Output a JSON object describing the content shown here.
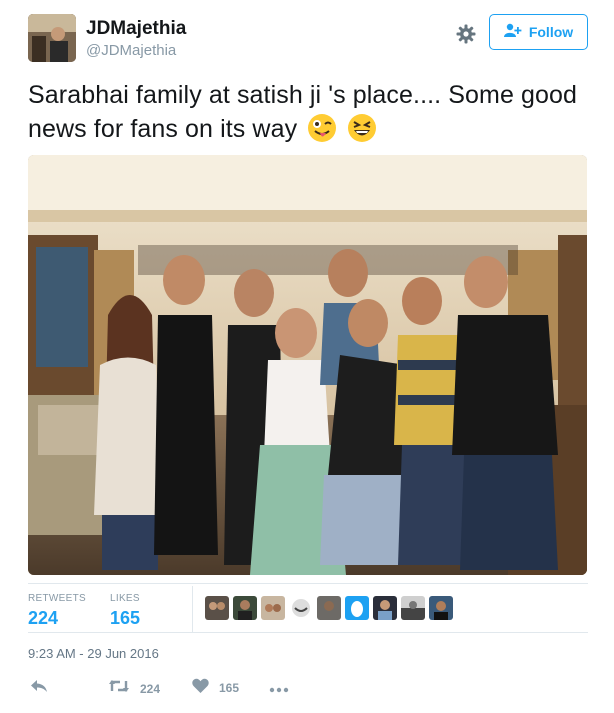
{
  "author": {
    "display_name": "JDMajethia",
    "handle": "@JDMajethia"
  },
  "follow_label": "Follow",
  "tweet": {
    "text": "Sarabhai family at satish ji 's place.... Some good news for fans on its way",
    "emojis": [
      "winking-face-with-tongue-emoji",
      "grinning-squinting-face-emoji"
    ]
  },
  "stats": {
    "retweets_label": "RETWEETS",
    "retweets_count": "224",
    "likes_label": "LIKES",
    "likes_count": "165"
  },
  "timestamp": "9:23 AM - 29 Jun 2016",
  "actions": {
    "reply_icon": "reply-icon",
    "retweet_icon": "retweet-icon",
    "retweet_count": "224",
    "like_icon": "heart-icon",
    "like_count": "165",
    "more_icon": "more-dots-icon"
  },
  "colors": {
    "accent": "#1da1f2",
    "muted": "#8899a6",
    "text": "#14171a",
    "border": "#e1e8ed"
  }
}
